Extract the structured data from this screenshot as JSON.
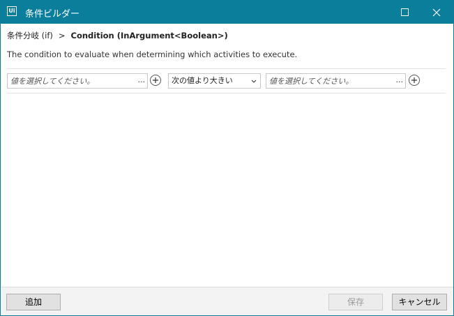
{
  "window": {
    "app_icon_text": "Ui",
    "title": "条件ビルダー"
  },
  "breadcrumb": {
    "parent": "条件分岐 (if)",
    "separator": ">",
    "current": "Condition (InArgument<Boolean>)"
  },
  "description": "The condition to evaluate when determining which activities to execute.",
  "condition": {
    "left_placeholder": "値を選択してください。",
    "left_ellipsis": "...",
    "operator": "次の値より大きい",
    "right_placeholder": "値を選択してください。",
    "right_ellipsis": "..."
  },
  "footer": {
    "add_label": "追加",
    "save_label": "保存",
    "cancel_label": "キャンセル"
  },
  "colors": {
    "titlebar": "#0a7e9b"
  }
}
